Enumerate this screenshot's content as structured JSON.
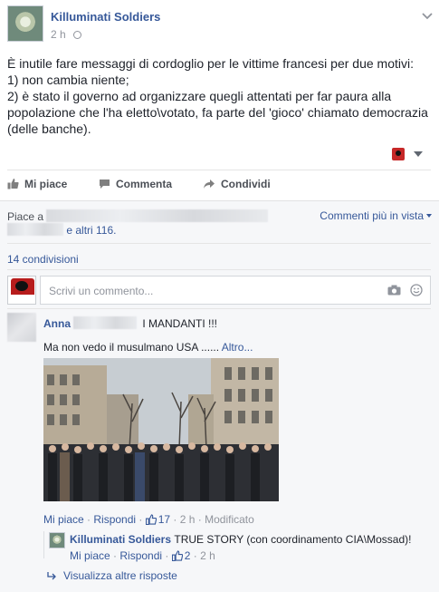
{
  "post": {
    "page_name": "Killuminati Soldiers",
    "time": "2 h",
    "body": "È inutile fare messaggi di cordoglio per le vittime francesi per due motivi:\n1) non cambia niente;\n2) è stato il governo ad organizzare quegli attentati per far paura alla popolazione che l'ha eletto\\votato, fa parte del 'gioco' chiamato democrazia (delle banche)."
  },
  "actions": {
    "like": "Mi piace",
    "comment": "Commenta",
    "share": "Condividi"
  },
  "likes": {
    "prefix": "Piace a",
    "and_others": "e altri 116.",
    "comments_view": "Commenti più in vista"
  },
  "shares": "14 condivisioni",
  "composer": {
    "placeholder": "Scrivi un commento..."
  },
  "comment": {
    "author": "Anna",
    "text_inline": "I MANDANTI !!!",
    "text_second": "Ma non vedo il musulmano USA ......",
    "more": "Altro...",
    "like": "Mi piace",
    "reply": "Rispondi",
    "like_count": "17",
    "time": "2 h",
    "edited": "Modificato"
  },
  "reply": {
    "author": "Killuminati Soldiers",
    "text": "TRUE STORY (con coordinamento CIA\\Mossad)!",
    "like": "Mi piace",
    "reply": "Rispondi",
    "like_count": "2",
    "time": "2 h"
  },
  "more_replies": "Visualizza altre risposte",
  "colors": {
    "link": "#365899",
    "meta": "#90949c",
    "panel": "#f6f7f9"
  }
}
